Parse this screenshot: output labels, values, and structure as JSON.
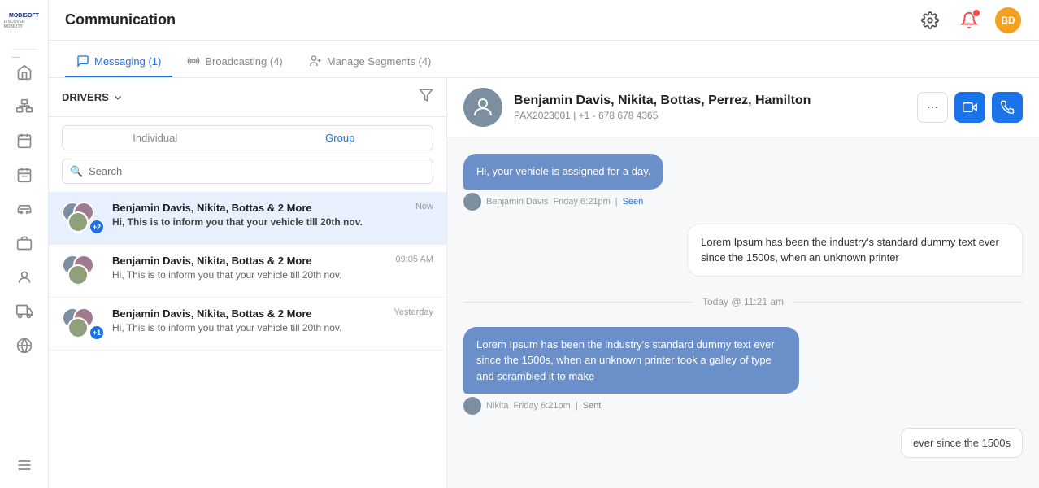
{
  "app": {
    "logo_line1": "MOBISOFT",
    "logo_line2": "DISCOVER MOBILITY",
    "title": "Communication"
  },
  "topbar": {
    "title": "Communication",
    "avatar_initials": "BD"
  },
  "tabs": [
    {
      "id": "messaging",
      "label": "Messaging (1)",
      "active": true,
      "icon": "message-icon"
    },
    {
      "id": "broadcasting",
      "label": "Broadcasting (4)",
      "active": false,
      "icon": "broadcast-icon"
    },
    {
      "id": "manage-segments",
      "label": "Manage Segments (4)",
      "active": false,
      "icon": "segments-icon"
    }
  ],
  "left_panel": {
    "drivers_label": "DRIVERS",
    "filter_button": "Filter",
    "toggle_individual": "Individual",
    "toggle_group": "Group",
    "search_placeholder": "Search",
    "conversations": [
      {
        "id": 1,
        "names": "Benjamin Davis, Nikita, Bottas & 2 More",
        "preview": "Hi, This is to inform you that your vehicle till 20th nov.",
        "time": "Now",
        "count_extra": "+2",
        "active": true
      },
      {
        "id": 2,
        "names": "Benjamin Davis, Nikita, Bottas & 2 More",
        "preview": "Hi, This is to inform you that your vehicle till 20th nov.",
        "time": "09:05 AM",
        "count_extra": "",
        "active": false
      },
      {
        "id": 3,
        "names": "Benjamin Davis, Nikita, Bottas & 2 More",
        "preview": "Hi, This is to inform you that your vehicle till 20th nov.",
        "time": "Yesterday",
        "count_extra": "+1",
        "active": false
      }
    ]
  },
  "chat": {
    "header_name": "Benjamin Davis, Nikita, Bottas, Perrez, Hamilton",
    "pax_id": "PAX2023001",
    "phone": "+1 - 678 678 4365",
    "messages": [
      {
        "id": 1,
        "type": "incoming",
        "text": "Hi, your vehicle is assigned for a day.",
        "sender": "Benjamin Davis",
        "time": "Friday 6:21pm",
        "status": "Seen"
      },
      {
        "id": 2,
        "type": "outgoing",
        "text": "Lorem Ipsum has been the industry's standard dummy text ever since the 1500s, when an unknown printer",
        "sender": "",
        "time": "",
        "status": ""
      }
    ],
    "date_divider": "Today @ 11:21 am",
    "messages2": [
      {
        "id": 3,
        "type": "incoming",
        "text": "Lorem Ipsum has been the industry's standard dummy text ever since the 1500s, when an unknown printer took a galley of type and scrambled it to make",
        "sender": "Nikita",
        "time": "Friday 6:21pm",
        "status": "Sent"
      }
    ],
    "bottom_message": "ever since the 1500s"
  }
}
